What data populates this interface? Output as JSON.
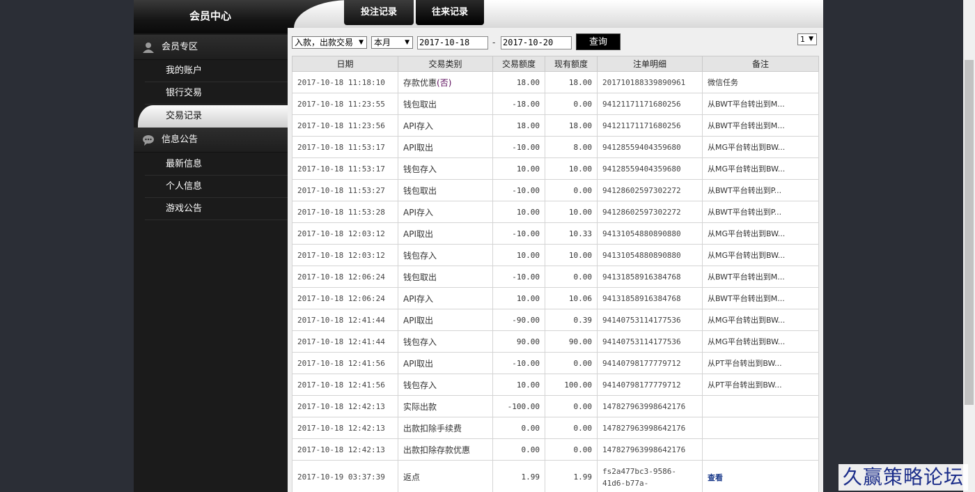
{
  "header": {
    "title": "会员中心",
    "tabs": [
      {
        "label": "投注记录"
      },
      {
        "label": "往来记录"
      }
    ]
  },
  "sidebar": {
    "sections": [
      {
        "label": "会员专区",
        "icon": "user-icon",
        "items": [
          {
            "label": "我的账户"
          },
          {
            "label": "银行交易"
          },
          {
            "label": "交易记录"
          }
        ]
      },
      {
        "label": "信息公告",
        "icon": "chat-icon",
        "items": [
          {
            "label": "最新信息"
          },
          {
            "label": "个人信息"
          },
          {
            "label": "游戏公告"
          }
        ]
      }
    ],
    "active_item": "交易记录"
  },
  "filters": {
    "type_select": "入款，出款交易",
    "period_select": "本月",
    "date_from": "2017-10-18",
    "date_separator": "-",
    "date_to": "2017-10-20",
    "query_label": "查询",
    "page_select": "1"
  },
  "table": {
    "headers": [
      "日期",
      "交易类别",
      "交易额度",
      "现有额度",
      "注单明细",
      "备注"
    ],
    "rows": [
      {
        "date": "2017-10-18 11:18:10",
        "type": "存款优惠",
        "type_suffix": "(否)",
        "amount": "18.00",
        "balance": "18.00",
        "detail": "201710188339890961",
        "note": "微信任务"
      },
      {
        "date": "2017-10-18 11:23:55",
        "type": "钱包取出",
        "amount": "-18.00",
        "balance": "0.00",
        "detail": "94121171171680256",
        "note": "从BWT平台转出到M..."
      },
      {
        "date": "2017-10-18 11:23:56",
        "type": "API存入",
        "amount": "18.00",
        "balance": "18.00",
        "detail": "94121171171680256",
        "note": "从BWT平台转出到M..."
      },
      {
        "date": "2017-10-18 11:53:17",
        "type": "API取出",
        "amount": "-10.00",
        "balance": "8.00",
        "detail": "94128559404359680",
        "note": "从MG平台转出到BW..."
      },
      {
        "date": "2017-10-18 11:53:17",
        "type": "钱包存入",
        "amount": "10.00",
        "balance": "10.00",
        "detail": "94128559404359680",
        "note": "从MG平台转出到BW..."
      },
      {
        "date": "2017-10-18 11:53:27",
        "type": "钱包取出",
        "amount": "-10.00",
        "balance": "0.00",
        "detail": "94128602597302272",
        "note": "从BWT平台转出到P..."
      },
      {
        "date": "2017-10-18 11:53:28",
        "type": "API存入",
        "amount": "10.00",
        "balance": "10.00",
        "detail": "94128602597302272",
        "note": "从BWT平台转出到P..."
      },
      {
        "date": "2017-10-18 12:03:12",
        "type": "API取出",
        "amount": "-10.00",
        "balance": "10.33",
        "detail": "94131054880890880",
        "note": "从MG平台转出到BW..."
      },
      {
        "date": "2017-10-18 12:03:12",
        "type": "钱包存入",
        "amount": "10.00",
        "balance": "10.00",
        "detail": "94131054880890880",
        "note": "从MG平台转出到BW..."
      },
      {
        "date": "2017-10-18 12:06:24",
        "type": "钱包取出",
        "amount": "-10.00",
        "balance": "0.00",
        "detail": "94131858916384768",
        "note": "从BWT平台转出到M..."
      },
      {
        "date": "2017-10-18 12:06:24",
        "type": "API存入",
        "amount": "10.00",
        "balance": "10.06",
        "detail": "94131858916384768",
        "note": "从BWT平台转出到M..."
      },
      {
        "date": "2017-10-18 12:41:44",
        "type": "API取出",
        "amount": "-90.00",
        "balance": "0.39",
        "detail": "94140753114177536",
        "note": "从MG平台转出到BW..."
      },
      {
        "date": "2017-10-18 12:41:44",
        "type": "钱包存入",
        "amount": "90.00",
        "balance": "90.00",
        "detail": "94140753114177536",
        "note": "从MG平台转出到BW..."
      },
      {
        "date": "2017-10-18 12:41:56",
        "type": "API取出",
        "amount": "-10.00",
        "balance": "0.00",
        "detail": "94140798177779712",
        "note": "从PT平台转出到BW..."
      },
      {
        "date": "2017-10-18 12:41:56",
        "type": "钱包存入",
        "amount": "10.00",
        "balance": "100.00",
        "detail": "94140798177779712",
        "note": "从PT平台转出到BW..."
      },
      {
        "date": "2017-10-18 12:42:13",
        "type": "实际出款",
        "amount": "-100.00",
        "balance": "0.00",
        "detail": "147827963998642176",
        "note": ""
      },
      {
        "date": "2017-10-18 12:42:13",
        "type": "出款扣除手续费",
        "amount": "0.00",
        "balance": "0.00",
        "detail": "147827963998642176",
        "note": ""
      },
      {
        "date": "2017-10-18 12:42:13",
        "type": "出款扣除存款优惠",
        "amount": "0.00",
        "balance": "0.00",
        "detail": "147827963998642176",
        "note": ""
      },
      {
        "date": "2017-10-19 03:37:39",
        "type": "返点",
        "amount": "1.99",
        "balance": "1.99",
        "detail": "fs2a477bc3-9586-41d6-b77a-",
        "note": "查看",
        "note_is_link": true
      }
    ]
  },
  "watermark": "久赢策略论坛"
}
